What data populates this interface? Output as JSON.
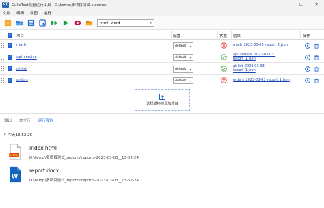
{
  "window": {
    "logo_text": "CT",
    "title": "CukeTest批量运行工具 - D:\\temp\\多项目测试.cukerun",
    "minimize": "—",
    "maximize": "☐",
    "close": "✕"
  },
  "menu": [
    "文件",
    "编辑",
    "视图",
    "运行"
  ],
  "toolbar": {
    "icons": [
      "new-icon",
      "open-folder-icon",
      "save-icon",
      "save-as-icon",
      "run-all-icon",
      "run-selected-icon",
      "view-icon",
      "open-folder-orange-icon"
    ],
    "format_value": "html, word",
    "format_caret": "▾"
  },
  "grid": {
    "headers": {
      "project": "项目",
      "profile": "配置",
      "status": "状态",
      "result": "结果",
      "actions": "操作"
    },
    "rows": [
      {
        "project": "math",
        "profile": "default",
        "status": "fail",
        "result": [
          "math_2023-03-03_report_2.json"
        ]
      },
      {
        "project": "api_service",
        "profile": "default",
        "status": "pass",
        "result": [
          "api_service_2023-03-03_",
          "report_1.json"
        ]
      },
      {
        "project": "gt-list",
        "profile": "default",
        "status": "pass",
        "result": [
          "gt-list_2023-03-03_",
          "report_1.json"
        ]
      },
      {
        "project": "orders",
        "profile": "default",
        "status": "fail",
        "result": [
          "orders_2023-03-03_report_1.json"
        ]
      }
    ],
    "add_project": "选择或拖拽添加项目",
    "add_plus": "+"
  },
  "output": {
    "tabs": [
      "输出",
      "命令行",
      "运行报告"
    ],
    "active_tab": 2,
    "date_chevron": "▾",
    "date": "今天13:52:25",
    "files": [
      {
        "name": "index.html",
        "path": "D:\\temp\\多项目测试_reports\\reports-2023-03-03__13-52-24",
        "icon": "html-file-icon",
        "icon_label": "HTML"
      },
      {
        "name": "report.docx",
        "path": "D:\\temp\\多项目测试_reports\\reports-2023-03-03__13-52-24",
        "icon": "word-file-icon",
        "icon_label": "W"
      }
    ]
  },
  "colors": {
    "accent": "#1e63d2",
    "fail": "#e53935",
    "pass": "#43a047",
    "link": "#1a46b0"
  }
}
